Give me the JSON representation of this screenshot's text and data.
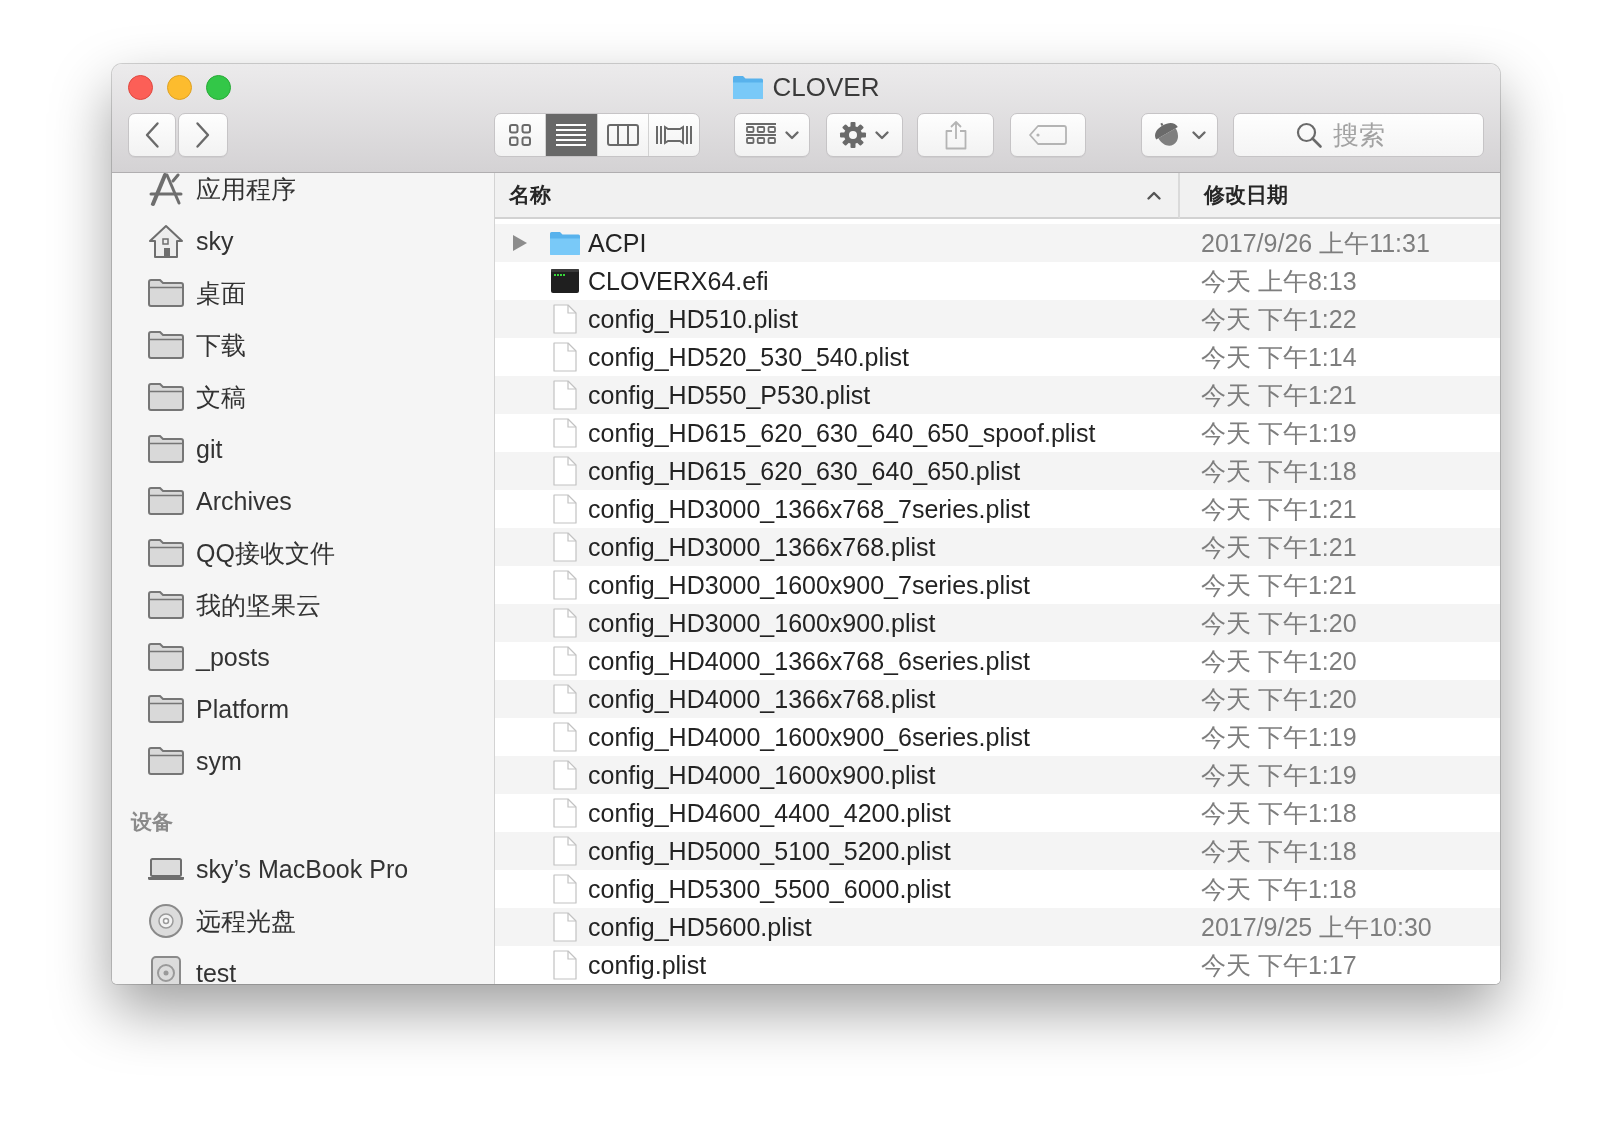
{
  "window": {
    "title": "CLOVER"
  },
  "toolbar": {
    "navigation": [
      {
        "kind": "back",
        "disabled": false
      },
      {
        "kind": "forward",
        "disabled": false
      }
    ],
    "view_buttons": [
      {
        "kind": "icons",
        "selected": false
      },
      {
        "kind": "list",
        "selected": true
      },
      {
        "kind": "columns",
        "selected": false
      },
      {
        "kind": "gallery",
        "selected": false
      }
    ],
    "buttons": [
      {
        "kind": "arrange",
        "disabled": false
      },
      {
        "kind": "action",
        "disabled": false
      },
      {
        "kind": "share",
        "disabled": true
      },
      {
        "kind": "tags",
        "disabled": true
      },
      {
        "kind": "acorn",
        "disabled": false
      }
    ],
    "search": {
      "placeholder": "搜索"
    }
  },
  "sidebar": {
    "sections": [
      {
        "items": [
          {
            "label": "应用程序",
            "kind": "applications",
            "selected": false
          },
          {
            "label": "sky",
            "kind": "home",
            "selected": false
          },
          {
            "label": "桌面",
            "kind": "folder",
            "selected": false
          },
          {
            "label": "下载",
            "kind": "folder",
            "selected": false
          },
          {
            "label": "文稿",
            "kind": "folder",
            "selected": false
          },
          {
            "label": "git",
            "kind": "folder",
            "selected": false
          },
          {
            "label": "Archives",
            "kind": "folder",
            "selected": false
          },
          {
            "label": "QQ接收文件",
            "kind": "folder",
            "selected": false
          },
          {
            "label": "我的坚果云",
            "kind": "folder",
            "selected": false
          },
          {
            "label": "_posts",
            "kind": "folder",
            "selected": false
          },
          {
            "label": "Platform",
            "kind": "folder",
            "selected": false
          },
          {
            "label": "sym",
            "kind": "folder",
            "selected": false
          }
        ]
      },
      {
        "title": "设备",
        "items": [
          {
            "label": "sky’s MacBook Pro",
            "kind": "laptop",
            "selected": false
          },
          {
            "label": "远程光盘",
            "kind": "disc",
            "selected": false
          },
          {
            "label": "test",
            "kind": "drive",
            "selected": false
          }
        ]
      }
    ]
  },
  "file_list": {
    "columns": [
      {
        "label": "名称",
        "sorted": true
      },
      {
        "label": "修改日期",
        "sorted": false
      }
    ],
    "rows": [
      {
        "name": "ACPI",
        "kind": "folder",
        "expanded": false,
        "date": "2017/9/26 上午11:31",
        "selected": false
      },
      {
        "name": "CLOVERX64.efi",
        "kind": "executable",
        "date": "今天 上午8:13",
        "selected": false
      },
      {
        "name": "config_HD510.plist",
        "kind": "document",
        "date": "今天 下午1:22",
        "selected": false
      },
      {
        "name": "config_HD520_530_540.plist",
        "kind": "document",
        "date": "今天 下午1:14",
        "selected": false
      },
      {
        "name": "config_HD550_P530.plist",
        "kind": "document",
        "date": "今天 下午1:21",
        "selected": false
      },
      {
        "name": "config_HD615_620_630_640_650_spoof.plist",
        "kind": "document",
        "date": "今天 下午1:19",
        "selected": false
      },
      {
        "name": "config_HD615_620_630_640_650.plist",
        "kind": "document",
        "date": "今天 下午1:18",
        "selected": false
      },
      {
        "name": "config_HD3000_1366x768_7series.plist",
        "kind": "document",
        "date": "今天 下午1:21",
        "selected": false
      },
      {
        "name": "config_HD3000_1366x768.plist",
        "kind": "document",
        "date": "今天 下午1:21",
        "selected": false
      },
      {
        "name": "config_HD3000_1600x900_7series.plist",
        "kind": "document",
        "date": "今天 下午1:21",
        "selected": false
      },
      {
        "name": "config_HD3000_1600x900.plist",
        "kind": "document",
        "date": "今天 下午1:20",
        "selected": false
      },
      {
        "name": "config_HD4000_1366x768_6series.plist",
        "kind": "document",
        "date": "今天 下午1:20",
        "selected": false
      },
      {
        "name": "config_HD4000_1366x768.plist",
        "kind": "document",
        "date": "今天 下午1:20",
        "selected": false
      },
      {
        "name": "config_HD4000_1600x900_6series.plist",
        "kind": "document",
        "date": "今天 下午1:19",
        "selected": false
      },
      {
        "name": "config_HD4000_1600x900.plist",
        "kind": "document",
        "date": "今天 下午1:19",
        "selected": false
      },
      {
        "name": "config_HD4600_4400_4200.plist",
        "kind": "document",
        "date": "今天 下午1:18",
        "selected": false
      },
      {
        "name": "config_HD5000_5100_5200.plist",
        "kind": "document",
        "date": "今天 下午1:18",
        "selected": false
      },
      {
        "name": "config_HD5300_5500_6000.plist",
        "kind": "document",
        "date": "今天 下午1:18",
        "selected": false
      },
      {
        "name": "config_HD5600.plist",
        "kind": "document",
        "date": "2017/9/25 上午10:30",
        "selected": false
      },
      {
        "name": "config.plist",
        "kind": "document",
        "date": "今天 下午1:17",
        "selected": false
      }
    ]
  }
}
